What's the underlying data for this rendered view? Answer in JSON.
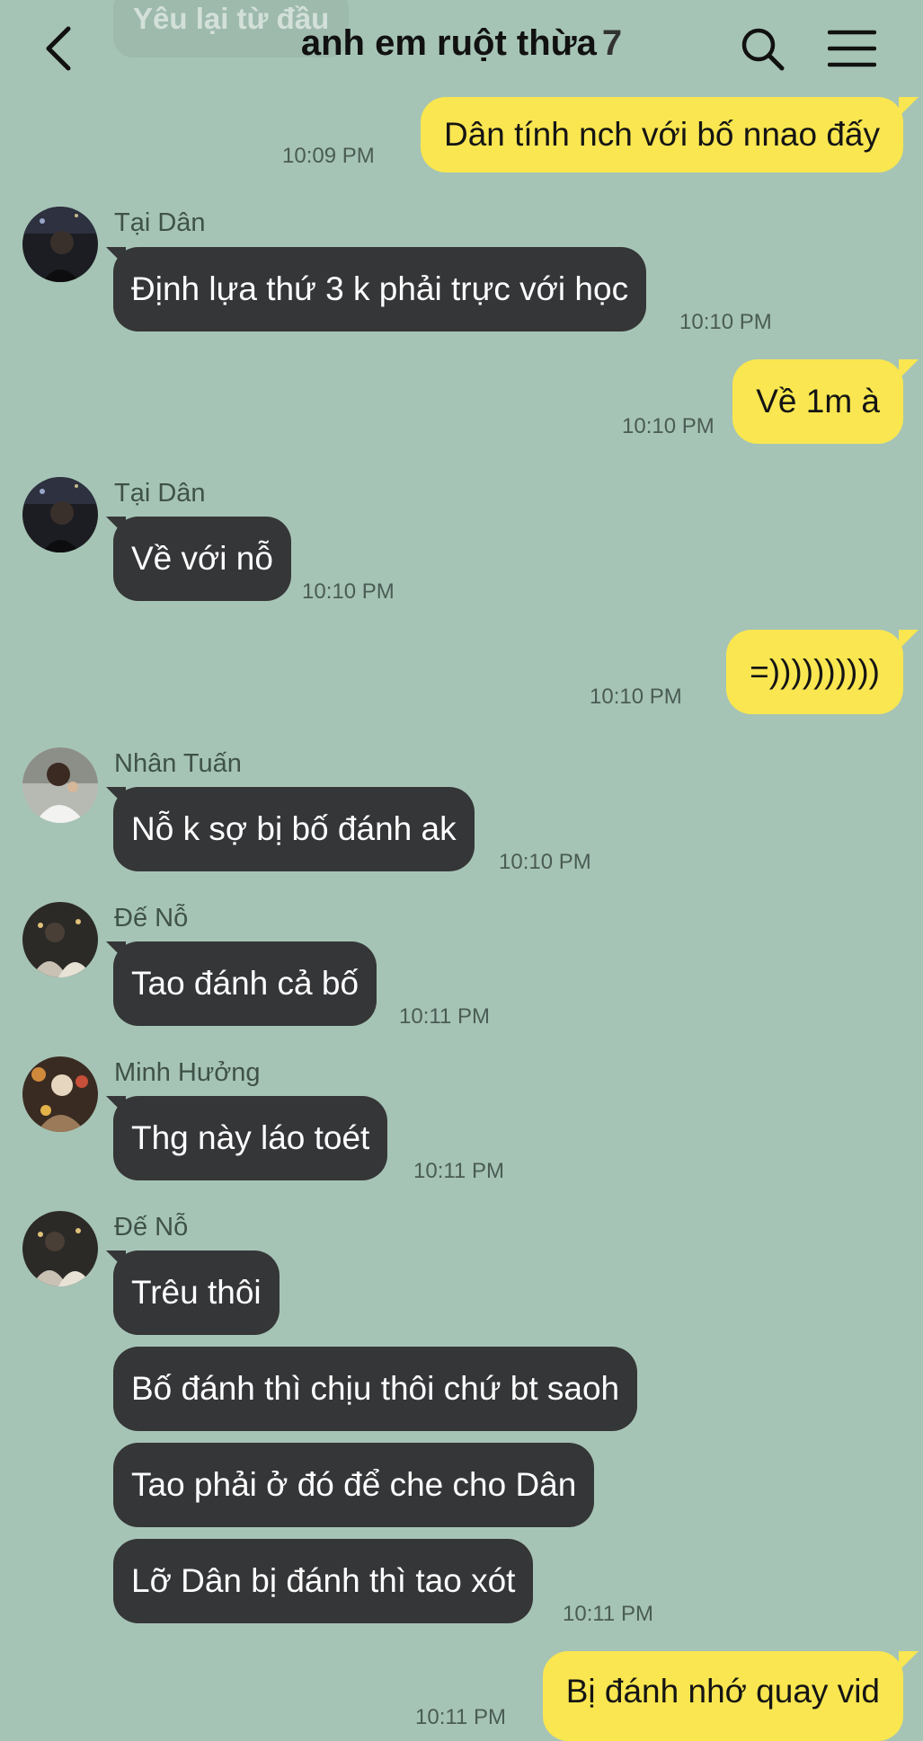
{
  "header": {
    "prev_message_preview": "Yêu lại từ đầu",
    "chat_title": "anh em ruột thừa",
    "member_count": "7",
    "back_icon": "chevron-left-icon",
    "search_icon": "search-icon",
    "menu_icon": "hamburger-menu-icon"
  },
  "colors": {
    "background": "#a6c4b5",
    "incoming_bubble": "#353638",
    "outgoing_bubble": "#f9e650"
  },
  "messages": [
    {
      "direction": "out",
      "text": "Dân tính nch với bố nnao đấy",
      "time": "10:09 PM"
    },
    {
      "direction": "in",
      "sender": "Tại Dân",
      "text": "Định lựa thứ 3 k phải trực với học",
      "time": "10:10 PM"
    },
    {
      "direction": "out",
      "text": "Về 1m à",
      "time": "10:10 PM"
    },
    {
      "direction": "in",
      "sender": "Tại Dân",
      "text": "Về với nỗ",
      "time": "10:10 PM"
    },
    {
      "direction": "out",
      "text": "=))))))))))",
      "time": "10:10 PM"
    },
    {
      "direction": "in",
      "sender": "Nhân Tuấn",
      "text": "Nỗ k sợ bị bố đánh ak",
      "time": "10:10 PM"
    },
    {
      "direction": "in",
      "sender": "Đế Nỗ",
      "text": "Tao đánh cả bố",
      "time": "10:11 PM"
    },
    {
      "direction": "in",
      "sender": "Minh Hưởng",
      "text": "Thg này láo toét",
      "time": "10:11 PM"
    },
    {
      "direction": "in",
      "sender": "Đế Nỗ",
      "texts": [
        "Trêu thôi",
        "Bố đánh thì chịu thôi chứ bt saoh",
        "Tao phải ở đó để che cho Dân",
        "Lỡ Dân bị đánh thì tao xót"
      ],
      "time": "10:11 PM"
    },
    {
      "direction": "out",
      "text": "Bị đánh nhớ quay vid",
      "time": "10:11 PM"
    }
  ]
}
